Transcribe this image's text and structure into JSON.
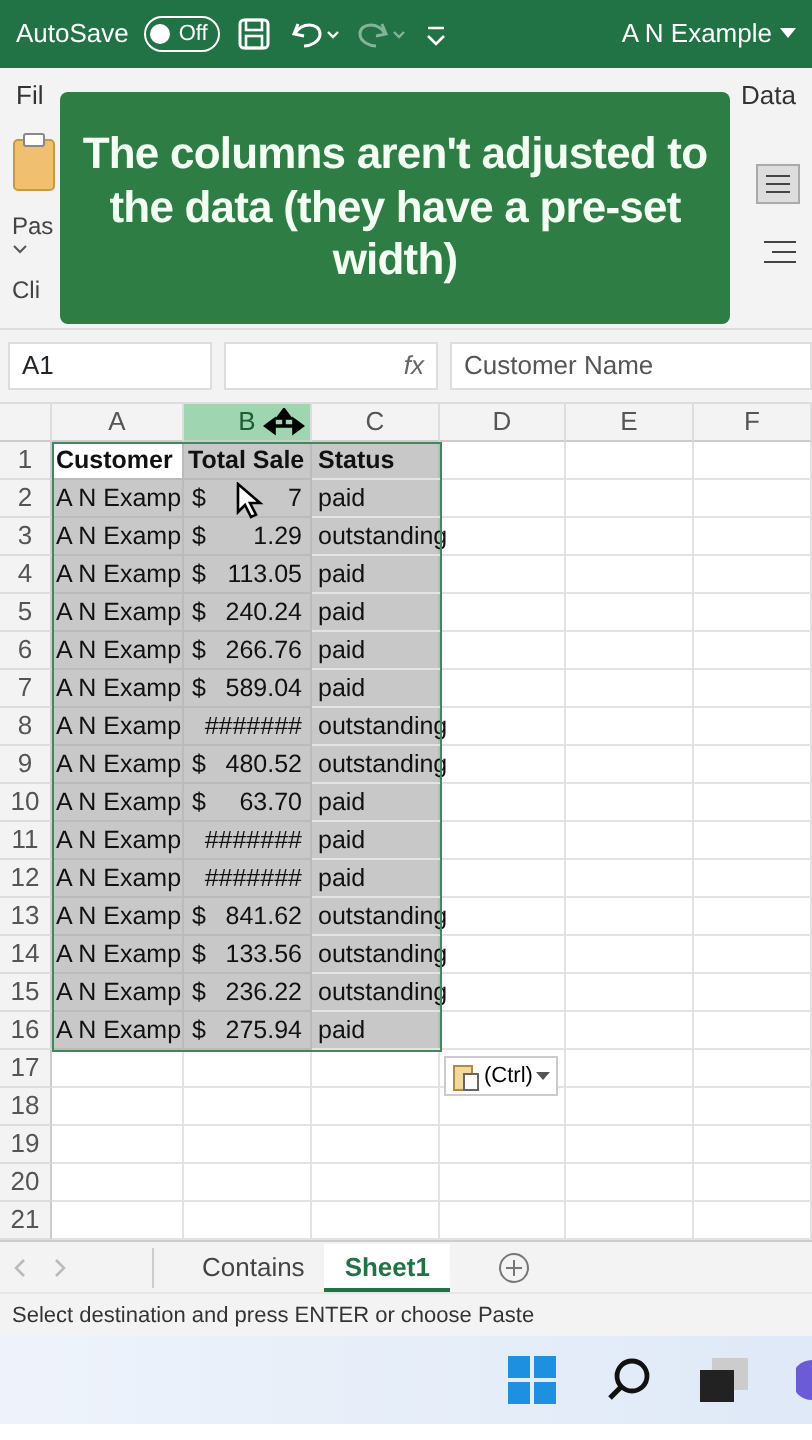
{
  "title_bar": {
    "autosave_label": "AutoSave",
    "autosave": {
      "label": "Off",
      "on": false
    },
    "document_title": "A N Example"
  },
  "ribbon": {
    "tabs": [
      {
        "label": "Fil",
        "selected": false
      },
      {
        "label": "Data",
        "selected": false
      }
    ],
    "paste_label": "Pas",
    "group_label": "Cli"
  },
  "callout": {
    "text": "The columns aren't adjusted to the data (they have a pre-set width)"
  },
  "formula_bar": {
    "name_box": "A1",
    "fx": "fx",
    "value": "Customer Name"
  },
  "sheet": {
    "columns": [
      {
        "label": "A",
        "selected": false
      },
      {
        "label": "B",
        "selected": true
      },
      {
        "label": "C",
        "selected": false
      },
      {
        "label": "D",
        "selected": false
      },
      {
        "label": "E",
        "selected": false
      },
      {
        "label": "F",
        "selected": false
      }
    ],
    "rows": [
      {
        "number": "1",
        "selected": true,
        "kind": "header",
        "cells": [
          {
            "kind": "text",
            "text": "Customer",
            "active": true
          },
          {
            "kind": "text",
            "text": "Total Sale",
            "active": false
          },
          {
            "kind": "text",
            "text": "Status",
            "active": false
          }
        ]
      },
      {
        "number": "2",
        "selected": true,
        "kind": "data",
        "cells": [
          {
            "kind": "text",
            "text": "A N Examp",
            "active": false
          },
          {
            "kind": "accounting",
            "currency": "$",
            "amount": "7",
            "active": false
          },
          {
            "kind": "text",
            "text": "paid",
            "active": false
          }
        ]
      },
      {
        "number": "3",
        "selected": true,
        "kind": "data",
        "cells": [
          {
            "kind": "text",
            "text": "A N Examp",
            "active": false
          },
          {
            "kind": "accounting",
            "currency": "$",
            "amount": "1.29",
            "active": false
          },
          {
            "kind": "text",
            "text": "outstanding",
            "active": false
          }
        ]
      },
      {
        "number": "4",
        "selected": true,
        "kind": "data",
        "cells": [
          {
            "kind": "text",
            "text": "A N Examp",
            "active": false
          },
          {
            "kind": "accounting",
            "currency": "$",
            "amount": "113.05",
            "active": false
          },
          {
            "kind": "text",
            "text": "paid",
            "active": false
          }
        ]
      },
      {
        "number": "5",
        "selected": true,
        "kind": "data",
        "cells": [
          {
            "kind": "text",
            "text": "A N Examp",
            "active": false
          },
          {
            "kind": "accounting",
            "currency": "$",
            "amount": "240.24",
            "active": false
          },
          {
            "kind": "text",
            "text": "paid",
            "active": false
          }
        ]
      },
      {
        "number": "6",
        "selected": true,
        "kind": "data",
        "cells": [
          {
            "kind": "text",
            "text": "A N Examp",
            "active": false
          },
          {
            "kind": "accounting",
            "currency": "$",
            "amount": "266.76",
            "active": false
          },
          {
            "kind": "text",
            "text": "paid",
            "active": false
          }
        ]
      },
      {
        "number": "7",
        "selected": true,
        "kind": "data",
        "cells": [
          {
            "kind": "text",
            "text": "A N Examp",
            "active": false
          },
          {
            "kind": "accounting",
            "currency": "$",
            "amount": "589.04",
            "active": false
          },
          {
            "kind": "text",
            "text": "paid",
            "active": false
          }
        ]
      },
      {
        "number": "8",
        "selected": true,
        "kind": "data",
        "cells": [
          {
            "kind": "text",
            "text": "A N Examp",
            "active": false
          },
          {
            "kind": "overflow",
            "text": "#######",
            "active": false
          },
          {
            "kind": "text",
            "text": "outstanding",
            "active": false
          }
        ]
      },
      {
        "number": "9",
        "selected": true,
        "kind": "data",
        "cells": [
          {
            "kind": "text",
            "text": "A N Examp",
            "active": false
          },
          {
            "kind": "accounting",
            "currency": "$",
            "amount": "480.52",
            "active": false
          },
          {
            "kind": "text",
            "text": "outstanding",
            "active": false
          }
        ]
      },
      {
        "number": "10",
        "selected": true,
        "kind": "data",
        "cells": [
          {
            "kind": "text",
            "text": "A N Examp",
            "active": false
          },
          {
            "kind": "accounting",
            "currency": "$",
            "amount": "63.70",
            "active": false
          },
          {
            "kind": "text",
            "text": "paid",
            "active": false
          }
        ]
      },
      {
        "number": "11",
        "selected": true,
        "kind": "data",
        "cells": [
          {
            "kind": "text",
            "text": "A N Examp",
            "active": false
          },
          {
            "kind": "overflow",
            "text": "#######",
            "active": false
          },
          {
            "kind": "text",
            "text": "paid",
            "active": false
          }
        ]
      },
      {
        "number": "12",
        "selected": true,
        "kind": "data",
        "cells": [
          {
            "kind": "text",
            "text": "A N Examp",
            "active": false
          },
          {
            "kind": "overflow",
            "text": "#######",
            "active": false
          },
          {
            "kind": "text",
            "text": "paid",
            "active": false
          }
        ]
      },
      {
        "number": "13",
        "selected": true,
        "kind": "data",
        "cells": [
          {
            "kind": "text",
            "text": "A N Examp",
            "active": false
          },
          {
            "kind": "accounting",
            "currency": "$",
            "amount": "841.62",
            "active": false
          },
          {
            "kind": "text",
            "text": "outstanding",
            "active": false
          }
        ]
      },
      {
        "number": "14",
        "selected": true,
        "kind": "data",
        "cells": [
          {
            "kind": "text",
            "text": "A N Examp",
            "active": false
          },
          {
            "kind": "accounting",
            "currency": "$",
            "amount": "133.56",
            "active": false
          },
          {
            "kind": "text",
            "text": "outstanding",
            "active": false
          }
        ]
      },
      {
        "number": "15",
        "selected": true,
        "kind": "data",
        "cells": [
          {
            "kind": "text",
            "text": "A N Examp",
            "active": false
          },
          {
            "kind": "accounting",
            "currency": "$",
            "amount": "236.22",
            "active": false
          },
          {
            "kind": "text",
            "text": "outstanding",
            "active": false
          }
        ]
      },
      {
        "number": "16",
        "selected": true,
        "kind": "data",
        "cells": [
          {
            "kind": "text",
            "text": "A N Examp",
            "active": false
          },
          {
            "kind": "accounting",
            "currency": "$",
            "amount": "275.94",
            "active": false
          },
          {
            "kind": "text",
            "text": "paid",
            "active": false
          }
        ]
      },
      {
        "number": "17",
        "selected": false,
        "kind": "empty"
      },
      {
        "number": "18",
        "selected": false,
        "kind": "empty"
      },
      {
        "number": "19",
        "selected": false,
        "kind": "empty"
      },
      {
        "number": "20",
        "selected": false,
        "kind": "empty"
      },
      {
        "number": "21",
        "selected": false,
        "kind": "empty"
      }
    ],
    "paste_options": {
      "label": "(Ctrl)"
    }
  },
  "sheet_tabs": [
    {
      "label": "Contains",
      "selected": false
    },
    {
      "label": "Sheet1",
      "selected": true
    }
  ],
  "status_bar": {
    "text": "Select destination and press ENTER or choose Paste"
  }
}
